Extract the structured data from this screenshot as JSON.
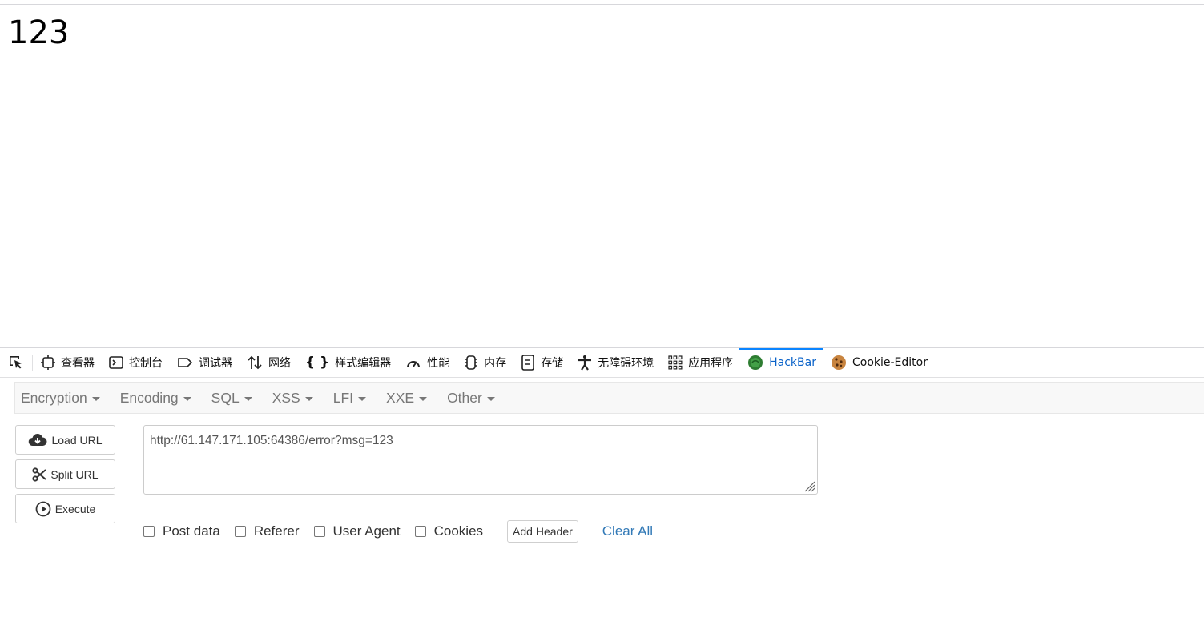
{
  "page": {
    "body_text": "123"
  },
  "devtools": {
    "tabs": [
      {
        "label": "查看器",
        "icon": "inspector-icon"
      },
      {
        "label": "控制台",
        "icon": "console-icon"
      },
      {
        "label": "调试器",
        "icon": "debugger-icon"
      },
      {
        "label": "网络",
        "icon": "network-icon"
      },
      {
        "label": "样式编辑器",
        "icon": "style-editor-icon"
      },
      {
        "label": "性能",
        "icon": "performance-icon"
      },
      {
        "label": "内存",
        "icon": "memory-icon"
      },
      {
        "label": "存储",
        "icon": "storage-icon"
      },
      {
        "label": "无障碍环境",
        "icon": "accessibility-icon"
      },
      {
        "label": "应用程序",
        "icon": "application-icon"
      },
      {
        "label": "HackBar",
        "icon": "hackbar-icon",
        "active": true
      },
      {
        "label": "Cookie-Editor",
        "icon": "cookie-icon"
      }
    ],
    "active_color": "#0b63c9"
  },
  "hackbar": {
    "menu": [
      "Encryption",
      "Encoding",
      "SQL",
      "XSS",
      "LFI",
      "XXE",
      "Other"
    ],
    "buttons": {
      "load_url": "Load URL",
      "split_url": "Split URL",
      "execute": "Execute"
    },
    "url_value": "http://61.147.171.105:64386/error?msg=123",
    "options": {
      "post_data": "Post data",
      "referer": "Referer",
      "user_agent": "User Agent",
      "cookies": "Cookies"
    },
    "add_header": "Add Header",
    "clear_all": "Clear All",
    "link_color": "#337ab7"
  }
}
